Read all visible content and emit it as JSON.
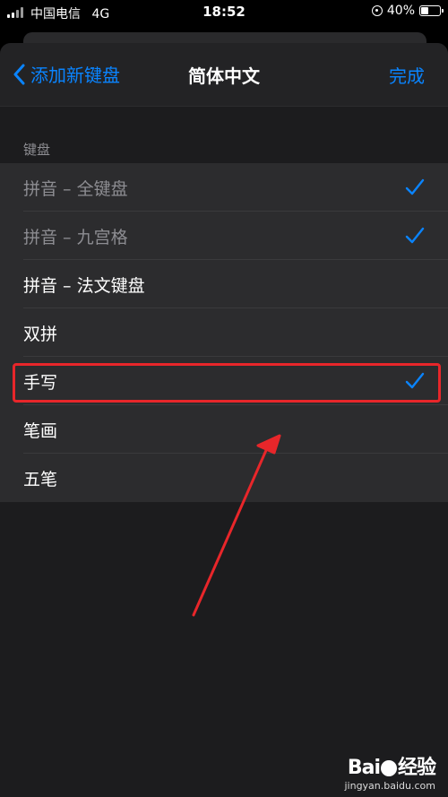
{
  "status_bar": {
    "carrier": "中国电信",
    "network": "4G",
    "time": "18:52",
    "battery": "40%",
    "battery_level": 0.4
  },
  "nav": {
    "back_label": "添加新键盘",
    "title": "简体中文",
    "done_label": "完成"
  },
  "section": {
    "header": "键盘"
  },
  "keyboards": [
    {
      "label": "拼音 – 全键盘",
      "checked": true,
      "disabled": true
    },
    {
      "label": "拼音 – 九宫格",
      "checked": true,
      "disabled": true
    },
    {
      "label": "拼音 – 法文键盘",
      "checked": false,
      "disabled": false
    },
    {
      "label": "双拼",
      "checked": false,
      "disabled": false
    },
    {
      "label": "手写",
      "checked": true,
      "disabled": false
    },
    {
      "label": "笔画",
      "checked": false,
      "disabled": false
    },
    {
      "label": "五笔",
      "checked": false,
      "disabled": false
    }
  ],
  "watermark": {
    "logo_left": "Bai",
    "logo_right": "经验",
    "url": "jingyan.baidu.com"
  },
  "colors": {
    "accent": "#0a84ff",
    "annotation": "#e8262a"
  }
}
